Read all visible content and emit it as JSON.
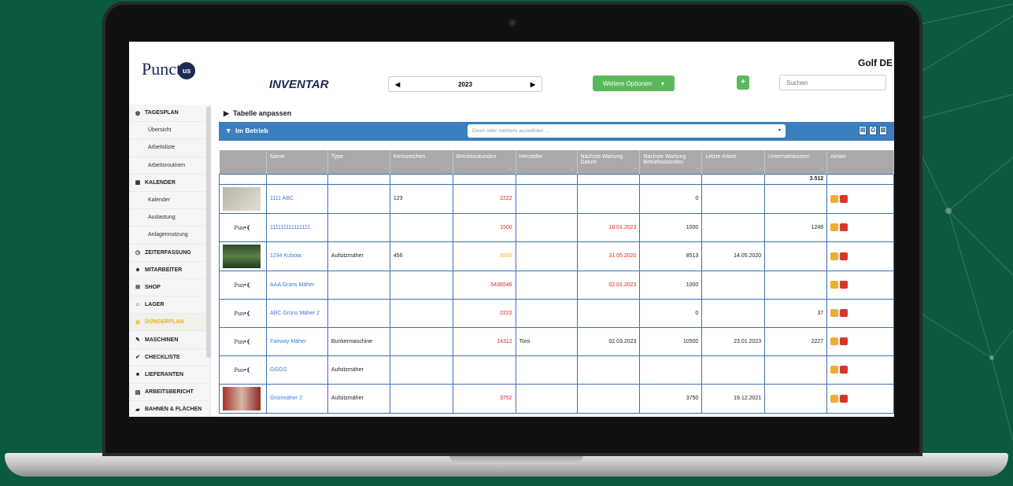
{
  "app": {
    "brand": "Punctus",
    "client": "Golf DE",
    "page_title": "INVENTAR"
  },
  "toolbar": {
    "year": "2023",
    "more_options": "Weitere Optionen",
    "plus": "+",
    "search_placeholder": "Suchen"
  },
  "sidebar": {
    "items": [
      {
        "label": "TAGESPLAN",
        "type": "head",
        "icon": "dashboard-icon"
      },
      {
        "label": "Übersicht",
        "type": "sub"
      },
      {
        "label": "Arbeitsliste",
        "type": "sub"
      },
      {
        "label": "Arbeitsroutinen",
        "type": "sub"
      },
      {
        "label": "KALENDER",
        "type": "head",
        "icon": "calendar-icon"
      },
      {
        "label": "Kalender",
        "type": "sub"
      },
      {
        "label": "Auslastung",
        "type": "sub"
      },
      {
        "label": "Anlagennutzung",
        "type": "sub"
      },
      {
        "label": "ZEITERFASSUNG",
        "type": "head",
        "icon": "clock-icon"
      },
      {
        "label": "MITARBEITER",
        "type": "head",
        "icon": "users-icon"
      },
      {
        "label": "SHOP",
        "type": "head",
        "icon": "cart-icon"
      },
      {
        "label": "LAGER",
        "type": "head",
        "icon": "warehouse-icon"
      },
      {
        "label": "DÜNGERPLAN",
        "type": "head",
        "icon": "fertilizer-icon",
        "active": true
      },
      {
        "label": "MASCHINEN",
        "type": "head",
        "icon": "wrench-icon"
      },
      {
        "label": "CHECKLISTE",
        "type": "head",
        "icon": "check-icon"
      },
      {
        "label": "LIEFERANTEN",
        "type": "head",
        "icon": "truck-icon"
      },
      {
        "label": "ARBEITSBERICHT",
        "type": "head",
        "icon": "report-icon"
      },
      {
        "label": "BAHNEN & FLÄCHEN",
        "type": "head",
        "icon": "map-icon"
      }
    ]
  },
  "main": {
    "customize_label": "Tabelle anpassen",
    "panel_title": "Im Betrieb",
    "multiselect_placeholder": "Einen oder mehrere auswählen ...",
    "columns": [
      "",
      "Name",
      "Type",
      "Kennzeichen",
      "Betriebsstunden",
      "Hersteller",
      "Nächste Wartung Datum",
      "Nächste Wartung Betriebsstunden",
      "Letzte Arbeit",
      "Unterhaltskosten",
      "Aktion"
    ],
    "sum_row": {
      "unterhaltskosten": "3.512"
    },
    "rows": [
      {
        "thumb": "photo",
        "name": "1111 ABC",
        "type": "",
        "kennzeichen": "123",
        "betriebsstunden": "2222",
        "bs_color": "red",
        "hersteller": "",
        "wartung_datum": "",
        "wd_color": "",
        "wartung_bs": "0",
        "letzte_arbeit": "",
        "kosten": ""
      },
      {
        "thumb": "logo",
        "name": "111111111111111",
        "type": "",
        "kennzeichen": "",
        "betriebsstunden": "1500",
        "bs_color": "red",
        "hersteller": "",
        "wartung_datum": "18.01.2023",
        "wd_color": "red",
        "wartung_bs": "1000",
        "letzte_arbeit": "",
        "kosten": "1248"
      },
      {
        "thumb": "photo-green",
        "name": "1234 Kubota",
        "type": "Aufsitzmäher",
        "kennzeichen": "456",
        "betriebsstunden": "8500",
        "bs_color": "orange",
        "hersteller": "",
        "wartung_datum": "31.05.2020",
        "wd_color": "red",
        "wartung_bs": "8513",
        "letzte_arbeit": "14.05.2020",
        "kosten": ""
      },
      {
        "thumb": "logo",
        "name": "AAA Grüns Mäher",
        "type": "",
        "kennzeichen": "",
        "betriebsstunden": "5436546",
        "bs_color": "red",
        "hersteller": "",
        "wartung_datum": "02.01.2023",
        "wd_color": "red",
        "wartung_bs": "1000",
        "letzte_arbeit": "",
        "kosten": ""
      },
      {
        "thumb": "logo",
        "name": "ABC Grüns Mäher 2",
        "type": "",
        "kennzeichen": "",
        "betriebsstunden": "2222",
        "bs_color": "red",
        "hersteller": "",
        "wartung_datum": "",
        "wd_color": "",
        "wartung_bs": "0",
        "letzte_arbeit": "",
        "kosten": "37"
      },
      {
        "thumb": "logo",
        "name": "Fairway Mäher",
        "type": "Bunkermaschine",
        "kennzeichen": "",
        "betriebsstunden": "14312",
        "bs_color": "red",
        "hersteller": "Toro",
        "wartung_datum": "02.03.2023",
        "wd_color": "",
        "wartung_bs": "10500",
        "letzte_arbeit": "23.01.2023",
        "kosten": "2227"
      },
      {
        "thumb": "logo",
        "name": "GGGG",
        "type": "Aufsitzmäher",
        "kennzeichen": "",
        "betriebsstunden": "",
        "bs_color": "",
        "hersteller": "",
        "wartung_datum": "",
        "wd_color": "",
        "wartung_bs": "",
        "letzte_arbeit": "",
        "kosten": ""
      },
      {
        "thumb": "photo-red",
        "name": "Grünmäher 2",
        "type": "Aufsitzmäher",
        "kennzeichen": "",
        "betriebsstunden": "3752",
        "bs_color": "red",
        "hersteller": "",
        "wartung_datum": "",
        "wd_color": "",
        "wartung_bs": "3750",
        "letzte_arbeit": "19.12.2021",
        "kosten": ""
      }
    ]
  },
  "colors": {
    "panel": "#3a80c1",
    "green": "#5cb85c",
    "red": "#e2231a",
    "orange": "#f0ad32",
    "header_gray": "#a9a9a9"
  }
}
